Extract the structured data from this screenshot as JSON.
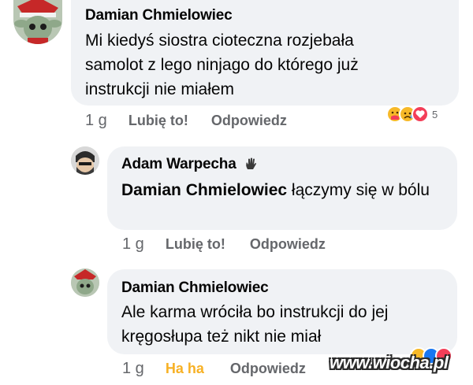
{
  "comments": [
    {
      "author": "Damian Chmielowiec",
      "text": "Mi kiedyś siostra cioteczna rozjebała samolot z lego ninjago do którego już instrukcji nie miałem",
      "time": "1 g",
      "like_label": "Lubię to!",
      "reply_label": "Odpowiedz",
      "reaction_count": "5"
    },
    {
      "author": "Adam Warpecha",
      "mention": "Damian Chmielowiec",
      "text": " łączymy się w bólu",
      "time": "1 g",
      "like_label": "Lubię to!",
      "reply_label": "Odpowiedz"
    },
    {
      "author": "Damian Chmielowiec",
      "text": "Ale karma wróciła bo instrukcji do jej kręgosłupa też nikt nie miał",
      "time": "1 g",
      "like_label": "Ha ha",
      "reply_label": "Odpowiedz"
    }
  ],
  "watermark": "www.wiocha.pl",
  "colors": {
    "bubble": "#f0f2f5",
    "secondary_text": "#65676b",
    "haha": "#f7b125",
    "heart": "#f33e58"
  }
}
